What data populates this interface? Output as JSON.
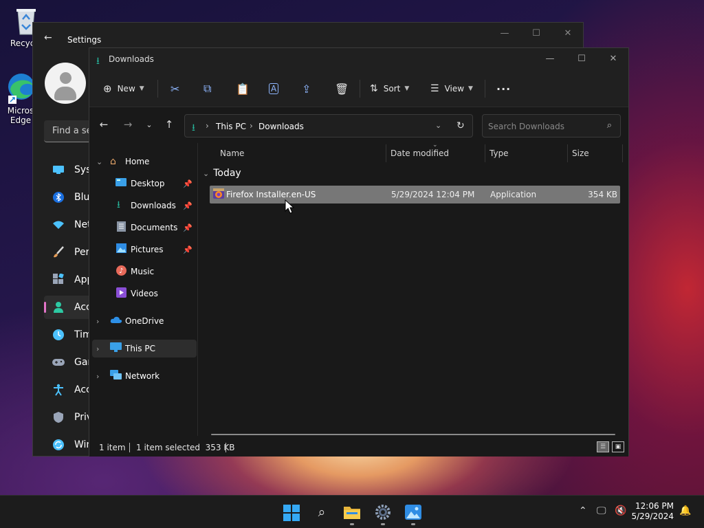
{
  "desktop": {
    "icons": [
      {
        "label": "Recycle",
        "icon": "recycle-bin-icon"
      },
      {
        "label": "Micros Edge",
        "label_lines": [
          "Micros",
          "Edge"
        ],
        "icon": "edge-icon"
      }
    ]
  },
  "settings": {
    "title": "Settings",
    "search_placeholder": "Find a se",
    "nav_items": [
      {
        "label": "Syst",
        "icon": "system-icon",
        "color": "#4cc2ff"
      },
      {
        "label": "Blue",
        "icon": "bluetooth-icon",
        "color": "#4a9dff"
      },
      {
        "label": "Net",
        "icon": "network-wifi-icon",
        "color": "#4cc2ff"
      },
      {
        "label": "Pers",
        "icon": "brush-icon",
        "color": "#e39b57"
      },
      {
        "label": "App",
        "icon": "apps-icon",
        "color": "#9aa5b8"
      },
      {
        "label": "Acc",
        "icon": "accounts-icon",
        "color": "#2dc9a3",
        "active": true
      },
      {
        "label": "Tim",
        "icon": "time-icon",
        "color": "#4cc2ff"
      },
      {
        "label": "Gar",
        "icon": "gaming-icon",
        "color": "#9aa5b8"
      },
      {
        "label": "Acc",
        "icon": "accessibility-icon",
        "color": "#4cc2ff"
      },
      {
        "label": "Priv",
        "icon": "privacy-shield-icon",
        "color": "#9aa5b8"
      },
      {
        "label": "Win",
        "icon": "windows-update-icon",
        "color": "#4cc2ff"
      }
    ]
  },
  "explorer": {
    "title": "Downloads",
    "toolbar": {
      "new_label": "New",
      "sort_label": "Sort",
      "view_label": "View",
      "more_label": "···"
    },
    "address": {
      "crumbs": [
        "This PC",
        "Downloads"
      ]
    },
    "search_placeholder": "Search Downloads",
    "nav_pane": [
      {
        "label": "Home",
        "icon": "home-icon",
        "expanded": true
      },
      {
        "label": "Desktop",
        "icon": "desktop-folder-icon",
        "pinned": true
      },
      {
        "label": "Downloads",
        "icon": "downloads-icon",
        "pinned": true
      },
      {
        "label": "Documents",
        "icon": "documents-icon",
        "pinned": true
      },
      {
        "label": "Pictures",
        "icon": "pictures-icon",
        "pinned": true
      },
      {
        "label": "Music",
        "icon": "music-icon"
      },
      {
        "label": "Videos",
        "icon": "videos-icon"
      },
      {
        "label": "OneDrive",
        "icon": "onedrive-icon"
      },
      {
        "label": "This PC",
        "icon": "this-pc-icon",
        "selected": true
      },
      {
        "label": "Network",
        "icon": "network-icon"
      }
    ],
    "columns": [
      "Name",
      "Date modified",
      "Type",
      "Size"
    ],
    "group_label": "Today",
    "files": [
      {
        "name": "Firefox Installer.en-US",
        "date": "5/29/2024 12:04 PM",
        "type": "Application",
        "size": "354 KB",
        "icon": "firefox-icon",
        "selected": true
      }
    ],
    "status": {
      "count": "1 item",
      "selection": "1 item selected  353 KB"
    }
  },
  "taskbar": {
    "apps": [
      "start-icon",
      "search-icon",
      "file-explorer-icon",
      "settings-icon",
      "photos-icon"
    ],
    "clock_time": "12:06 PM",
    "clock_date": "5/29/2024"
  },
  "colors": {
    "accent_teal": "#27b59b",
    "selection_gray": "#777777",
    "window_bg": "#191919",
    "settings_accent": "#e374c8"
  }
}
